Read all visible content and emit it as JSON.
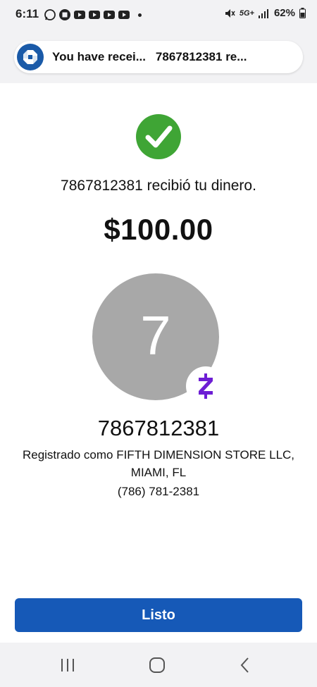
{
  "status_bar": {
    "time": "6:11",
    "network": "5G+",
    "battery": "62%",
    "notification_icons": [
      "whatsapp-icon",
      "app-icon",
      "youtube-icon",
      "youtube-icon",
      "youtube-icon",
      "youtube-icon"
    ]
  },
  "notification": {
    "app_icon": "chase-logo-icon",
    "title": "You have recei...",
    "body": "7867812381 re..."
  },
  "confirmation": {
    "icon": "check-circle-icon",
    "message": "7867812381 recibió tu dinero.",
    "amount": "$100.00"
  },
  "recipient": {
    "avatar_initial": "7",
    "badge_icon": "zelle-icon",
    "phone_title": "7867812381",
    "registered_line1": "Registrado como FIFTH DIMENSION STORE LLC,",
    "registered_line2": "MIAMI, FL",
    "phone_formatted": "(786) 781-2381"
  },
  "actions": {
    "done_label": "Listo"
  },
  "colors": {
    "primary_button": "#1659b7",
    "success_green": "#3fa535",
    "zelle_purple": "#6d1ed4",
    "avatar_gray": "#a8a8a8"
  }
}
